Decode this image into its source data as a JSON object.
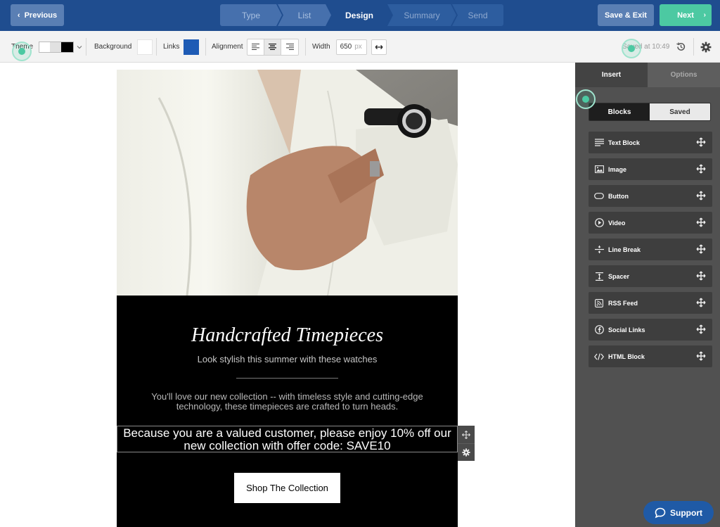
{
  "topbar": {
    "previous_label": "Previous",
    "steps": [
      {
        "label": "Type",
        "state": "done"
      },
      {
        "label": "List",
        "state": "done"
      },
      {
        "label": "Design",
        "state": "active"
      },
      {
        "label": "Summary",
        "state": "future"
      },
      {
        "label": "Send",
        "state": "future"
      }
    ],
    "save_exit_label": "Save & Exit",
    "next_label": "Next"
  },
  "toolbar": {
    "theme_label": "Theme",
    "background_label": "Background",
    "links_label": "Links",
    "links_color": "#1e5bb5",
    "alignment_label": "Alignment",
    "alignment_options": [
      "align-left-icon",
      "align-center-icon",
      "align-right-icon"
    ],
    "alignment_selected": "center",
    "width_label": "Width",
    "width_value": "650",
    "width_unit": "px",
    "saved_status": "Saved at 10:49"
  },
  "email": {
    "title": "Handcrafted Timepieces",
    "subtitle": "Look stylish this summer with these watches",
    "body": "You'll love our new collection -- with timeless style and cutting-edge technology, these timepieces are crafted to turn heads.",
    "offer": "Because you are a valued customer, please enjoy 10% off our new collection with offer code: SAVE10",
    "cta_label": "Shop The Collection"
  },
  "sidebar": {
    "tabs": [
      {
        "label": "Insert",
        "active": true
      },
      {
        "label": "Options",
        "active": false
      }
    ],
    "segments": [
      {
        "label": "Blocks",
        "active": true
      },
      {
        "label": "Saved",
        "active": false
      }
    ],
    "blocks": [
      {
        "label": "Text Block",
        "icon": "text-lines-icon"
      },
      {
        "label": "Image",
        "icon": "image-icon"
      },
      {
        "label": "Button",
        "icon": "button-icon"
      },
      {
        "label": "Video",
        "icon": "play-icon"
      },
      {
        "label": "Line Break",
        "icon": "line-break-icon"
      },
      {
        "label": "Spacer",
        "icon": "spacer-icon"
      },
      {
        "label": "RSS Feed",
        "icon": "rss-icon"
      },
      {
        "label": "Social Links",
        "icon": "facebook-icon"
      },
      {
        "label": "HTML Block",
        "icon": "code-icon"
      }
    ]
  },
  "support_label": "Support",
  "colors": {
    "topbar": "#1f4d8f",
    "accent_green": "#4cc9a2",
    "sidebar": "#515151",
    "support_blue": "#1f5aa6"
  }
}
